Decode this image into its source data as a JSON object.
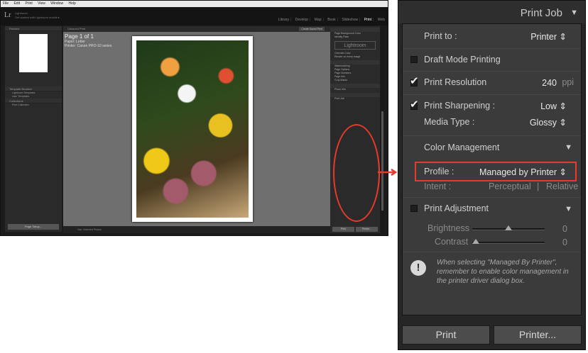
{
  "lightroom": {
    "logo": "Lr",
    "identity_lines": [
      "Lightroom",
      "Get started with Lightroom mobile ▸"
    ],
    "menu": [
      "File",
      "Edit",
      "Print",
      "View",
      "Window",
      "Help"
    ],
    "modules": [
      "Library",
      "Develop",
      "Map",
      "Book",
      "Slideshow",
      "Print",
      "Web"
    ],
    "active_module": "Print",
    "left_panel": {
      "preview_header": "Preview",
      "template_header": "Template Browser",
      "templates": [
        "Lightroom Templates",
        "User Templates"
      ],
      "collections_header": "Collections",
      "collection_item": "Print Collection",
      "page_setup": "Page Setup..."
    },
    "center": {
      "topbar": "Unsaved Print",
      "save_button": "Create Saved Print",
      "page_title": "Page 1 of 1",
      "page_paper": "Paper: Letter",
      "page_printer": "Printer: Canon PRO-10 series",
      "filmstrip_text": "Use: Selected Photos"
    },
    "right_panel": {
      "rows": [
        "Page Background Color",
        "Identity Plate",
        "Override Color",
        "Render on every image",
        "Watermarking",
        "Page Options",
        "Page Numbers",
        "Page Info",
        "Crop Marks",
        "Photo Info",
        "Print Job"
      ],
      "watermark": "Lightroom",
      "print_button": "Print",
      "printer_button": "Printer..."
    }
  },
  "panel": {
    "title": "Print Job",
    "print_to": {
      "label": "Print to :",
      "value": "Printer"
    },
    "draft_mode": {
      "label": "Draft Mode Printing",
      "checked": false
    },
    "resolution": {
      "label": "Print Resolution",
      "value": "240",
      "unit": "ppi",
      "checked": true
    },
    "sharpening": {
      "label": "Print Sharpening :",
      "value": "Low",
      "checked": true
    },
    "media_type": {
      "label": "Media Type :",
      "value": "Glossy"
    },
    "color_management": {
      "label": "Color Management"
    },
    "profile": {
      "label": "Profile :",
      "value": "Managed by Printer"
    },
    "intent": {
      "label": "Intent :",
      "option1": "Perceptual",
      "separator": "|",
      "option2": "Relative"
    },
    "print_adjustment": {
      "label": "Print Adjustment",
      "checked": false
    },
    "brightness": {
      "label": "Brightness",
      "value": "0"
    },
    "contrast": {
      "label": "Contrast",
      "value": "0"
    },
    "info_icon": "!",
    "info_text": "When selecting \"Managed By Printer\", remember to enable color management in the printer driver dialog box.",
    "print_button": "Print",
    "printer_button": "Printer..."
  },
  "colors": {
    "highlight": "#e83a2a",
    "panel_bg": "#3b3b3b"
  }
}
